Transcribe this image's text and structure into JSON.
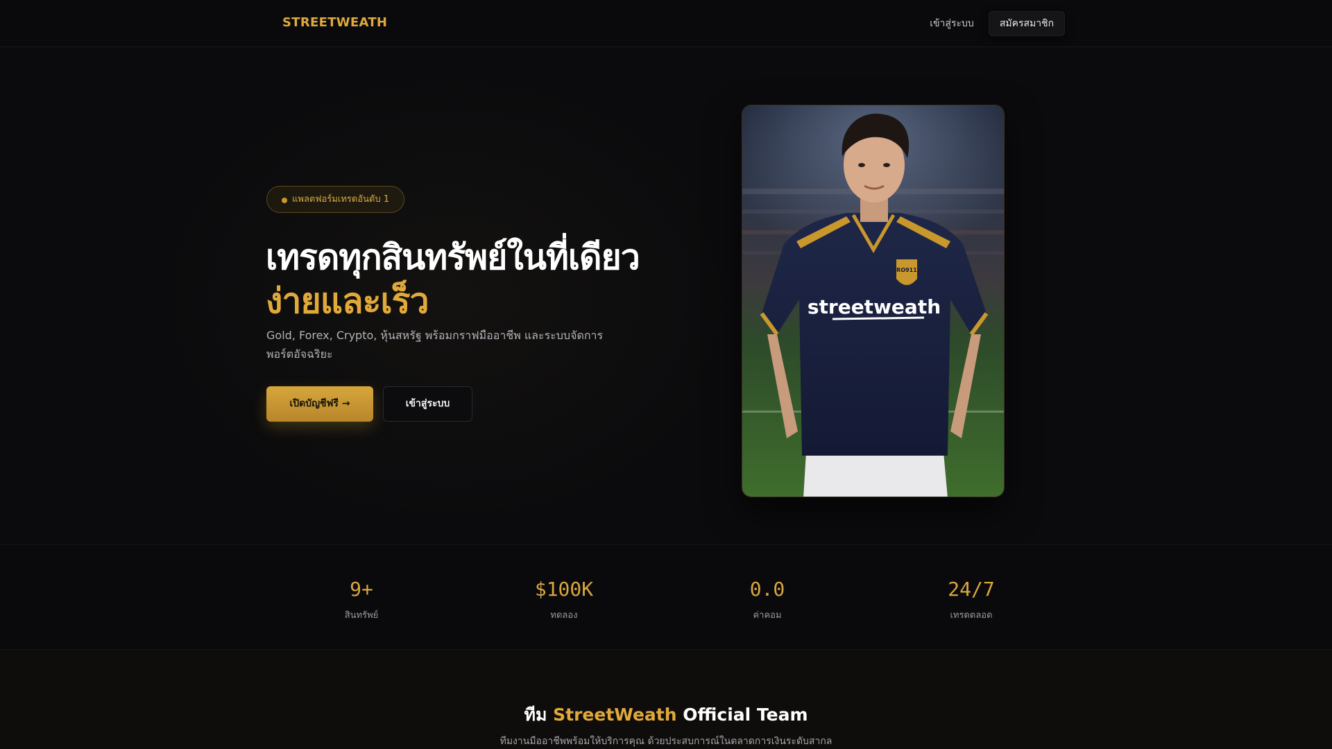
{
  "nav": {
    "brand": "STREETWEATH",
    "login_label": "เข้าสู่ระบบ",
    "register_label": "สมัครสมาชิก"
  },
  "hero": {
    "badge": "แพลตฟอร์มเทรดอันดับ 1",
    "headline_line1": "เทรดทุกสินทรัพย์ในที่เดียว",
    "headline_line2": "ง่ายและเร็ว",
    "subtext": "Gold, Forex, Crypto, หุ้นสหรัฐ พร้อมกราฟมืออาชีพ และระบบจัดการพอร์ตอัจฉริยะ",
    "cta_primary": "เปิดบัญชีฟรี →",
    "cta_secondary": "เข้าสู่ระบบ",
    "photo": {
      "subject": "player in navy jersey",
      "jersey_text": "streetweath",
      "crest_text": "RO911"
    }
  },
  "stats": [
    {
      "value": "9+",
      "label": "สินทรัพย์"
    },
    {
      "value": "$100K",
      "label": "ทดลอง"
    },
    {
      "value": "0.0",
      "label": "ค่าคอม"
    },
    {
      "value": "24/7",
      "label": "เทรดตลอด"
    }
  ],
  "team": {
    "title_prefix": "ทีม ",
    "title_accent": "StreetWeath",
    "title_suffix": " Official Team",
    "subtitle": "ทีมงานมืออาชีพพร้อมให้บริการคุณ ด้วยประสบการณ์ในตลาดการเงินระดับสากล"
  },
  "colors": {
    "accent": "#e0a93a",
    "background": "#0b0b0d"
  }
}
